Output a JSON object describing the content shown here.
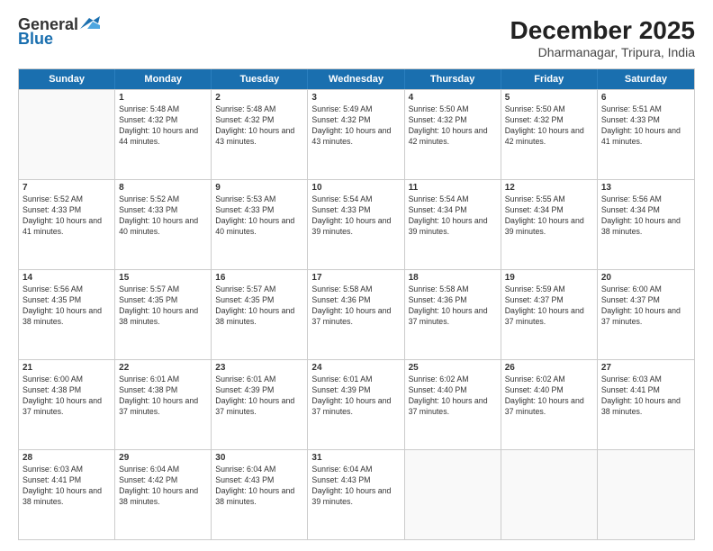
{
  "logo": {
    "general": "General",
    "blue": "Blue"
  },
  "title": "December 2025",
  "subtitle": "Dharmanagar, Tripura, India",
  "header_days": [
    "Sunday",
    "Monday",
    "Tuesday",
    "Wednesday",
    "Thursday",
    "Friday",
    "Saturday"
  ],
  "weeks": [
    [
      {
        "day": "",
        "sunrise": "",
        "sunset": "",
        "daylight": ""
      },
      {
        "day": "1",
        "sunrise": "Sunrise: 5:48 AM",
        "sunset": "Sunset: 4:32 PM",
        "daylight": "Daylight: 10 hours and 44 minutes."
      },
      {
        "day": "2",
        "sunrise": "Sunrise: 5:48 AM",
        "sunset": "Sunset: 4:32 PM",
        "daylight": "Daylight: 10 hours and 43 minutes."
      },
      {
        "day": "3",
        "sunrise": "Sunrise: 5:49 AM",
        "sunset": "Sunset: 4:32 PM",
        "daylight": "Daylight: 10 hours and 43 minutes."
      },
      {
        "day": "4",
        "sunrise": "Sunrise: 5:50 AM",
        "sunset": "Sunset: 4:32 PM",
        "daylight": "Daylight: 10 hours and 42 minutes."
      },
      {
        "day": "5",
        "sunrise": "Sunrise: 5:50 AM",
        "sunset": "Sunset: 4:32 PM",
        "daylight": "Daylight: 10 hours and 42 minutes."
      },
      {
        "day": "6",
        "sunrise": "Sunrise: 5:51 AM",
        "sunset": "Sunset: 4:33 PM",
        "daylight": "Daylight: 10 hours and 41 minutes."
      }
    ],
    [
      {
        "day": "7",
        "sunrise": "Sunrise: 5:52 AM",
        "sunset": "Sunset: 4:33 PM",
        "daylight": "Daylight: 10 hours and 41 minutes."
      },
      {
        "day": "8",
        "sunrise": "Sunrise: 5:52 AM",
        "sunset": "Sunset: 4:33 PM",
        "daylight": "Daylight: 10 hours and 40 minutes."
      },
      {
        "day": "9",
        "sunrise": "Sunrise: 5:53 AM",
        "sunset": "Sunset: 4:33 PM",
        "daylight": "Daylight: 10 hours and 40 minutes."
      },
      {
        "day": "10",
        "sunrise": "Sunrise: 5:54 AM",
        "sunset": "Sunset: 4:33 PM",
        "daylight": "Daylight: 10 hours and 39 minutes."
      },
      {
        "day": "11",
        "sunrise": "Sunrise: 5:54 AM",
        "sunset": "Sunset: 4:34 PM",
        "daylight": "Daylight: 10 hours and 39 minutes."
      },
      {
        "day": "12",
        "sunrise": "Sunrise: 5:55 AM",
        "sunset": "Sunset: 4:34 PM",
        "daylight": "Daylight: 10 hours and 39 minutes."
      },
      {
        "day": "13",
        "sunrise": "Sunrise: 5:56 AM",
        "sunset": "Sunset: 4:34 PM",
        "daylight": "Daylight: 10 hours and 38 minutes."
      }
    ],
    [
      {
        "day": "14",
        "sunrise": "Sunrise: 5:56 AM",
        "sunset": "Sunset: 4:35 PM",
        "daylight": "Daylight: 10 hours and 38 minutes."
      },
      {
        "day": "15",
        "sunrise": "Sunrise: 5:57 AM",
        "sunset": "Sunset: 4:35 PM",
        "daylight": "Daylight: 10 hours and 38 minutes."
      },
      {
        "day": "16",
        "sunrise": "Sunrise: 5:57 AM",
        "sunset": "Sunset: 4:35 PM",
        "daylight": "Daylight: 10 hours and 38 minutes."
      },
      {
        "day": "17",
        "sunrise": "Sunrise: 5:58 AM",
        "sunset": "Sunset: 4:36 PM",
        "daylight": "Daylight: 10 hours and 37 minutes."
      },
      {
        "day": "18",
        "sunrise": "Sunrise: 5:58 AM",
        "sunset": "Sunset: 4:36 PM",
        "daylight": "Daylight: 10 hours and 37 minutes."
      },
      {
        "day": "19",
        "sunrise": "Sunrise: 5:59 AM",
        "sunset": "Sunset: 4:37 PM",
        "daylight": "Daylight: 10 hours and 37 minutes."
      },
      {
        "day": "20",
        "sunrise": "Sunrise: 6:00 AM",
        "sunset": "Sunset: 4:37 PM",
        "daylight": "Daylight: 10 hours and 37 minutes."
      }
    ],
    [
      {
        "day": "21",
        "sunrise": "Sunrise: 6:00 AM",
        "sunset": "Sunset: 4:38 PM",
        "daylight": "Daylight: 10 hours and 37 minutes."
      },
      {
        "day": "22",
        "sunrise": "Sunrise: 6:01 AM",
        "sunset": "Sunset: 4:38 PM",
        "daylight": "Daylight: 10 hours and 37 minutes."
      },
      {
        "day": "23",
        "sunrise": "Sunrise: 6:01 AM",
        "sunset": "Sunset: 4:39 PM",
        "daylight": "Daylight: 10 hours and 37 minutes."
      },
      {
        "day": "24",
        "sunrise": "Sunrise: 6:01 AM",
        "sunset": "Sunset: 4:39 PM",
        "daylight": "Daylight: 10 hours and 37 minutes."
      },
      {
        "day": "25",
        "sunrise": "Sunrise: 6:02 AM",
        "sunset": "Sunset: 4:40 PM",
        "daylight": "Daylight: 10 hours and 37 minutes."
      },
      {
        "day": "26",
        "sunrise": "Sunrise: 6:02 AM",
        "sunset": "Sunset: 4:40 PM",
        "daylight": "Daylight: 10 hours and 37 minutes."
      },
      {
        "day": "27",
        "sunrise": "Sunrise: 6:03 AM",
        "sunset": "Sunset: 4:41 PM",
        "daylight": "Daylight: 10 hours and 38 minutes."
      }
    ],
    [
      {
        "day": "28",
        "sunrise": "Sunrise: 6:03 AM",
        "sunset": "Sunset: 4:41 PM",
        "daylight": "Daylight: 10 hours and 38 minutes."
      },
      {
        "day": "29",
        "sunrise": "Sunrise: 6:04 AM",
        "sunset": "Sunset: 4:42 PM",
        "daylight": "Daylight: 10 hours and 38 minutes."
      },
      {
        "day": "30",
        "sunrise": "Sunrise: 6:04 AM",
        "sunset": "Sunset: 4:43 PM",
        "daylight": "Daylight: 10 hours and 38 minutes."
      },
      {
        "day": "31",
        "sunrise": "Sunrise: 6:04 AM",
        "sunset": "Sunset: 4:43 PM",
        "daylight": "Daylight: 10 hours and 39 minutes."
      },
      {
        "day": "",
        "sunrise": "",
        "sunset": "",
        "daylight": ""
      },
      {
        "day": "",
        "sunrise": "",
        "sunset": "",
        "daylight": ""
      },
      {
        "day": "",
        "sunrise": "",
        "sunset": "",
        "daylight": ""
      }
    ]
  ]
}
